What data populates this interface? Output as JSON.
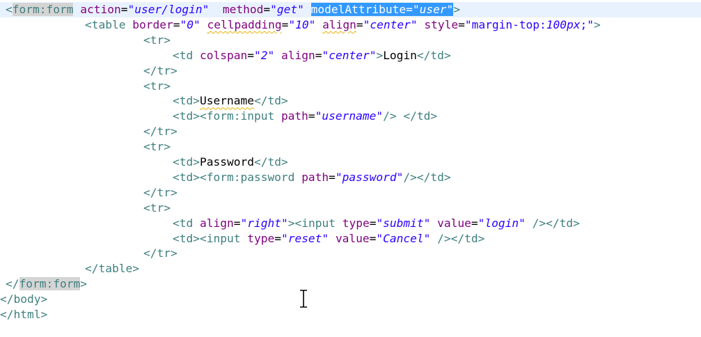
{
  "editor": {
    "language": "jsp",
    "current_line_index": 0,
    "lines": [
      {
        "indent": 8,
        "tokens": [
          {
            "t": "tag",
            "s": "<"
          },
          {
            "t": "tag",
            "s": "form:form",
            "mark": "matched"
          },
          {
            "t": "txt",
            "s": " "
          },
          {
            "t": "attr",
            "s": "action"
          },
          {
            "t": "eq",
            "s": "="
          },
          {
            "t": "val",
            "s": "\"user/login\""
          },
          {
            "t": "txt",
            "s": "  "
          },
          {
            "t": "attr",
            "s": "method"
          },
          {
            "t": "eq",
            "s": "="
          },
          {
            "t": "val",
            "s": "\"get\""
          },
          {
            "t": "txt",
            "s": " "
          },
          {
            "t": "attr",
            "s": "modelAttribute",
            "mark": "selected"
          },
          {
            "t": "eq",
            "s": "=",
            "mark": "selected"
          },
          {
            "t": "val",
            "s": "\"user\"",
            "mark": "selected"
          },
          {
            "t": "tag",
            "s": ">"
          }
        ]
      },
      {
        "indent": 122,
        "tokens": [
          {
            "t": "tag",
            "s": "<table"
          },
          {
            "t": "txt",
            "s": " "
          },
          {
            "t": "attr",
            "s": "border"
          },
          {
            "t": "eq",
            "s": "="
          },
          {
            "t": "val",
            "s": "\"0\""
          },
          {
            "t": "txt",
            "s": " "
          },
          {
            "t": "attr",
            "s": "cellpadding",
            "mark": "squiggle"
          },
          {
            "t": "eq",
            "s": "="
          },
          {
            "t": "val",
            "s": "\"10\""
          },
          {
            "t": "txt",
            "s": " "
          },
          {
            "t": "attr",
            "s": "align",
            "mark": "squiggle"
          },
          {
            "t": "eq",
            "s": "="
          },
          {
            "t": "val",
            "s": "\"center\""
          },
          {
            "t": "txt",
            "s": " "
          },
          {
            "t": "attr",
            "s": "style"
          },
          {
            "t": "eq",
            "s": "="
          },
          {
            "t": "val-s",
            "s": "\"margin-top:"
          },
          {
            "t": "val",
            "s": "100px"
          },
          {
            "t": "val-s",
            "s": ";\""
          },
          {
            "t": "tag",
            "s": ">"
          }
        ]
      },
      {
        "indent": 206,
        "tokens": [
          {
            "t": "tag",
            "s": "<tr>"
          }
        ]
      },
      {
        "indent": 248,
        "tokens": [
          {
            "t": "tag",
            "s": "<td"
          },
          {
            "t": "txt",
            "s": " "
          },
          {
            "t": "attr",
            "s": "colspan"
          },
          {
            "t": "eq",
            "s": "="
          },
          {
            "t": "val",
            "s": "\"2\""
          },
          {
            "t": "txt",
            "s": " "
          },
          {
            "t": "attr",
            "s": "align"
          },
          {
            "t": "eq",
            "s": "="
          },
          {
            "t": "val",
            "s": "\"center\""
          },
          {
            "t": "tag",
            "s": ">"
          },
          {
            "t": "txt",
            "s": "Login"
          },
          {
            "t": "tag",
            "s": "</td>"
          }
        ]
      },
      {
        "indent": 206,
        "tokens": [
          {
            "t": "tag",
            "s": "</tr>"
          }
        ]
      },
      {
        "indent": 206,
        "tokens": [
          {
            "t": "tag",
            "s": "<tr>"
          }
        ]
      },
      {
        "indent": 248,
        "tokens": [
          {
            "t": "tag",
            "s": "<td>"
          },
          {
            "t": "txt",
            "s": "Username",
            "mark": "squiggle"
          },
          {
            "t": "tag",
            "s": "</td>"
          }
        ]
      },
      {
        "indent": 248,
        "tokens": [
          {
            "t": "tag",
            "s": "<td><form:input"
          },
          {
            "t": "txt",
            "s": " "
          },
          {
            "t": "attr",
            "s": "path"
          },
          {
            "t": "eq",
            "s": "="
          },
          {
            "t": "val",
            "s": "\"username\""
          },
          {
            "t": "tag",
            "s": "/>"
          },
          {
            "t": "txt",
            "s": " "
          },
          {
            "t": "tag",
            "s": "</td>"
          }
        ]
      },
      {
        "indent": 206,
        "tokens": [
          {
            "t": "tag",
            "s": "</tr>"
          }
        ]
      },
      {
        "indent": 206,
        "tokens": [
          {
            "t": "tag",
            "s": "<tr>"
          }
        ]
      },
      {
        "indent": 248,
        "tokens": [
          {
            "t": "tag",
            "s": "<td>"
          },
          {
            "t": "txt",
            "s": "Password"
          },
          {
            "t": "tag",
            "s": "</td>"
          }
        ]
      },
      {
        "indent": 248,
        "tokens": [
          {
            "t": "tag",
            "s": "<td><form:password"
          },
          {
            "t": "txt",
            "s": " "
          },
          {
            "t": "attr",
            "s": "path"
          },
          {
            "t": "eq",
            "s": "="
          },
          {
            "t": "val",
            "s": "\"password\""
          },
          {
            "t": "tag",
            "s": "/></td>"
          }
        ]
      },
      {
        "indent": 206,
        "tokens": [
          {
            "t": "tag",
            "s": "</tr>"
          }
        ]
      },
      {
        "indent": 206,
        "tokens": [
          {
            "t": "tag",
            "s": "<tr>"
          }
        ]
      },
      {
        "indent": 248,
        "tokens": [
          {
            "t": "tag",
            "s": "<td"
          },
          {
            "t": "txt",
            "s": " "
          },
          {
            "t": "attr",
            "s": "align"
          },
          {
            "t": "eq",
            "s": "="
          },
          {
            "t": "val",
            "s": "\"right\""
          },
          {
            "t": "tag",
            "s": "><input"
          },
          {
            "t": "txt",
            "s": " "
          },
          {
            "t": "attr",
            "s": "type"
          },
          {
            "t": "eq",
            "s": "="
          },
          {
            "t": "val",
            "s": "\"submit\""
          },
          {
            "t": "txt",
            "s": " "
          },
          {
            "t": "attr",
            "s": "value"
          },
          {
            "t": "eq",
            "s": "="
          },
          {
            "t": "val",
            "s": "\"login\""
          },
          {
            "t": "txt",
            "s": " "
          },
          {
            "t": "tag",
            "s": "/></td>"
          }
        ]
      },
      {
        "indent": 248,
        "tokens": [
          {
            "t": "tag",
            "s": "<td><input"
          },
          {
            "t": "txt",
            "s": " "
          },
          {
            "t": "attr",
            "s": "type"
          },
          {
            "t": "eq",
            "s": "="
          },
          {
            "t": "val",
            "s": "\"reset\""
          },
          {
            "t": "txt",
            "s": " "
          },
          {
            "t": "attr",
            "s": "value"
          },
          {
            "t": "eq",
            "s": "="
          },
          {
            "t": "val",
            "s": "\"Cancel\""
          },
          {
            "t": "txt",
            "s": " "
          },
          {
            "t": "tag",
            "s": "/></td>"
          }
        ]
      },
      {
        "indent": 206,
        "tokens": [
          {
            "t": "tag",
            "s": "</tr>"
          }
        ]
      },
      {
        "indent": 122,
        "tokens": [
          {
            "t": "tag",
            "s": "</table>"
          }
        ]
      },
      {
        "indent": 8,
        "tokens": [
          {
            "t": "tag",
            "s": "</"
          },
          {
            "t": "tag",
            "s": "form:form",
            "mark": "matched"
          },
          {
            "t": "tag",
            "s": ">"
          }
        ]
      },
      {
        "indent": 0,
        "tokens": [
          {
            "t": "tag",
            "s": "</body>"
          }
        ]
      },
      {
        "indent": 0,
        "tokens": [
          {
            "t": "tag",
            "s": "</html>"
          }
        ]
      }
    ]
  },
  "cursor": {
    "icon": "text-ibeam-cursor-icon"
  }
}
